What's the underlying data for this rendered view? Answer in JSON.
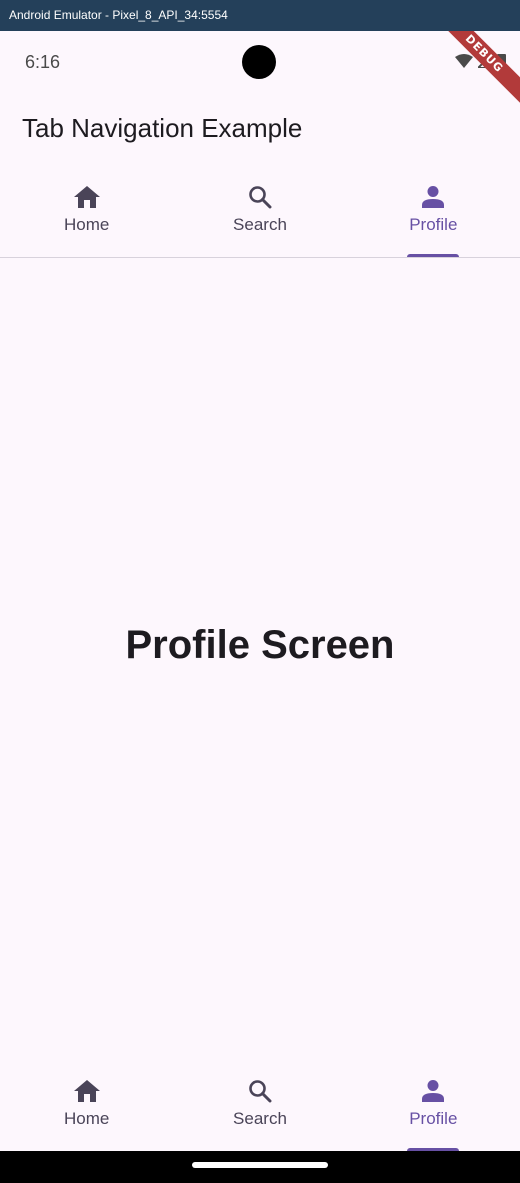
{
  "window": {
    "title": "Android Emulator - Pixel_8_API_34:5554"
  },
  "status_bar": {
    "time": "6:16",
    "icons": [
      "wifi-icon",
      "signal-icon",
      "battery-icon"
    ]
  },
  "debug_banner": "DEBUG",
  "app_bar": {
    "title": "Tab Navigation Example"
  },
  "tabs": [
    {
      "label": "Home",
      "icon": "home-icon",
      "active": false
    },
    {
      "label": "Search",
      "icon": "search-icon",
      "active": false
    },
    {
      "label": "Profile",
      "icon": "person-icon",
      "active": true
    }
  ],
  "main": {
    "heading": "Profile Screen"
  },
  "colors": {
    "accent": "#6750a4",
    "background": "#fdf7fd",
    "inactive": "#4a4458",
    "text": "#1d1b20"
  }
}
